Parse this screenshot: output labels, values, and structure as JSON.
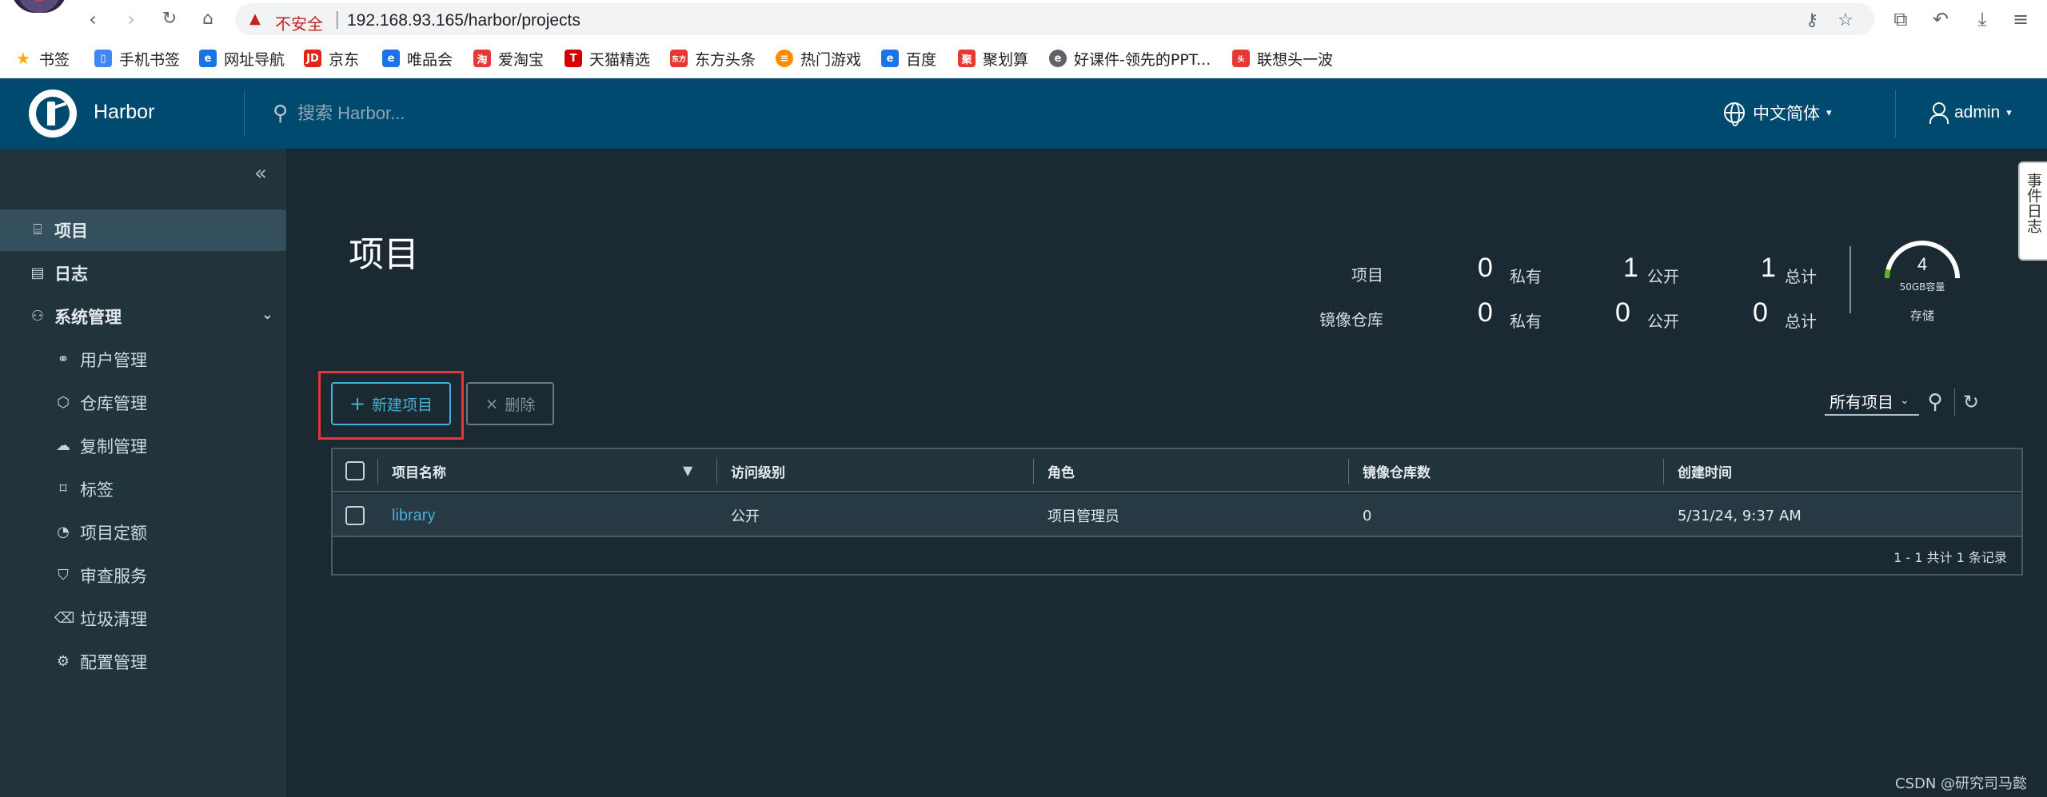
{
  "browser": {
    "insecure_label": "不安全",
    "url": "192.168.93.165/harbor/projects",
    "bookmarks": [
      {
        "label": "书签",
        "color": "#f9ab00"
      },
      {
        "label": "手机书签",
        "color": "#4285f4"
      },
      {
        "label": "网址导航",
        "color": "#1a73e8"
      },
      {
        "label": "京东",
        "color": "#e2231a"
      },
      {
        "label": "唯品会",
        "color": "#1a73e8"
      },
      {
        "label": "爱淘宝",
        "color": "#e53935"
      },
      {
        "label": "天猫精选",
        "color": "#d50000"
      },
      {
        "label": "东方头条",
        "color": "#e53935"
      },
      {
        "label": "热门游戏",
        "color": "#fb8c00"
      },
      {
        "label": "百度",
        "color": "#1a73e8"
      },
      {
        "label": "聚划算",
        "color": "#e53935"
      },
      {
        "label": "好课件-领先的PPT...",
        "color": "#5f6368"
      },
      {
        "label": "联想头一波",
        "color": "#e53935"
      }
    ]
  },
  "header": {
    "brand": "Harbor",
    "search_placeholder": "搜索 Harbor...",
    "language": "中文简体",
    "user": "admin",
    "brand_color": "#004a70"
  },
  "sidebar": {
    "items": [
      {
        "label": "项目",
        "icon": "projects-icon"
      },
      {
        "label": "日志",
        "icon": "log-icon"
      },
      {
        "label": "系统管理",
        "icon": "admin-icon"
      }
    ],
    "sub_items": [
      {
        "label": "用户管理",
        "icon": "users-icon"
      },
      {
        "label": "仓库管理",
        "icon": "registry-icon"
      },
      {
        "label": "复制管理",
        "icon": "replication-icon"
      },
      {
        "label": "标签",
        "icon": "tag-icon"
      },
      {
        "label": "项目定额",
        "icon": "quota-icon"
      },
      {
        "label": "审查服务",
        "icon": "shield-icon"
      },
      {
        "label": "垃圾清理",
        "icon": "trash-icon"
      },
      {
        "label": "配置管理",
        "icon": "gear-icon"
      }
    ]
  },
  "main": {
    "title": "项目",
    "stats": {
      "projects_label": "项目",
      "repos_label": "镜像仓库",
      "private_unit": "私有",
      "public_unit": "公开",
      "total_unit": "总计",
      "projects_private": "0",
      "projects_public": "1",
      "projects_total": "1",
      "repos_private": "0",
      "repos_public": "0",
      "repos_total": "0"
    },
    "storage": {
      "value": "4",
      "capacity": "50GB容量",
      "label": "存储",
      "used_fraction": 0.08
    },
    "new_project_label": "新建项目",
    "delete_label": "删除",
    "filter_label": "所有项目",
    "table": {
      "columns": [
        "项目名称",
        "访问级别",
        "角色",
        "镜像仓库数",
        "创建时间"
      ],
      "rows": [
        {
          "name": "library",
          "access": "公开",
          "role": "项目管理员",
          "repo_count": "0",
          "created": "5/31/24, 9:37 AM"
        }
      ],
      "footer": "1 - 1 共计 1 条记录"
    },
    "event_tab": "事件日志"
  },
  "watermark": "CSDN @研究司马懿"
}
